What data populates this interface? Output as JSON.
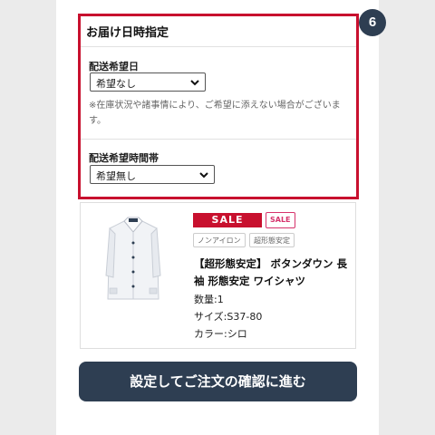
{
  "step_badge": "6",
  "delivery": {
    "title": "お届け日時指定",
    "date_label": "配送希望日",
    "date_value": "希望なし",
    "note": "※在庫状況や諸事情により、ご希望に添えない場合がございます。",
    "time_label": "配送希望時間帯",
    "time_value": "希望無し"
  },
  "product": {
    "sale_badge": "SALE",
    "sale_tag": "SALE",
    "tags": [
      "ノンアイロン",
      "超形態安定"
    ],
    "name": "【超形態安定】 ボタンダウン 長袖 形態安定 ワイシャツ",
    "quantity": "数量:1",
    "size": "サイズ:S37-80",
    "color": "カラー:シロ"
  },
  "cta_label": "設定してご注文の確認に進む",
  "colors": {
    "accent_red": "#c8102e",
    "navy": "#2e3e52"
  }
}
